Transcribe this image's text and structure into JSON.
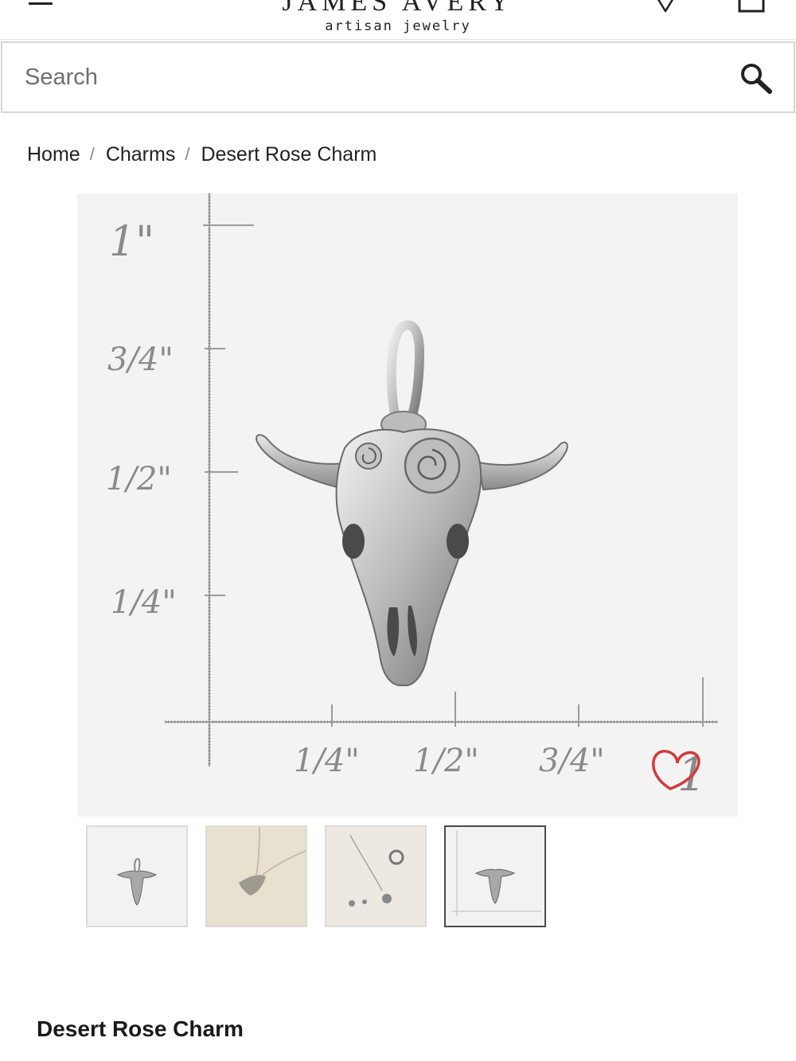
{
  "header": {
    "logo_main": "JAMES AVERY",
    "logo_sub": "artisan jewelry",
    "menu_icon": "hamburger-icon",
    "store_icon": "location-pin-icon",
    "bag_icon": "shopping-bag-icon"
  },
  "search": {
    "placeholder": "Search",
    "icon": "search-icon"
  },
  "breadcrumb": {
    "items": [
      "Home",
      "Charms",
      "Desert Rose Charm"
    ],
    "separator": "/"
  },
  "main_image": {
    "vertical_labels": [
      "1\"",
      "3/4\"",
      "1/2\"",
      "1/4\""
    ],
    "horizontal_labels": [
      "1/4\"",
      "1/2\"",
      "3/4\""
    ],
    "corner_label": "1",
    "heart_icon": "heart-icon",
    "colors": {
      "heart": "#d23c3c",
      "background": "#f3f3f3"
    }
  },
  "thumbnails": {
    "count": 4,
    "selected_index": 3
  },
  "product": {
    "title": "Desert Rose Charm"
  }
}
